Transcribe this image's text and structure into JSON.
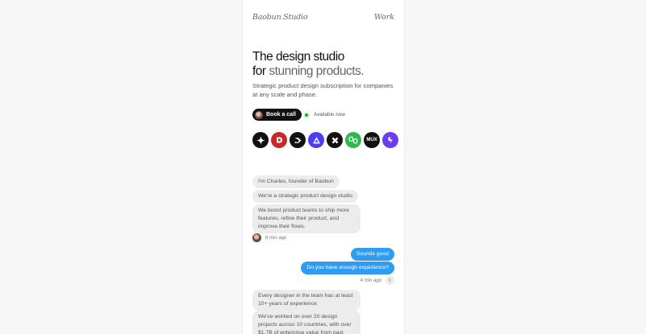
{
  "nav": {
    "brand": "Baobun.Studio",
    "work_link": "Work"
  },
  "hero": {
    "title_line1": "The design studio",
    "title_line2_dark": "for",
    "title_line2_muted": " stunning products.",
    "subtitle": "Strategic product design subscription for companies at any scale and phase."
  },
  "cta": {
    "book_label": "Book a call",
    "availability": "Available now"
  },
  "logos": [
    {
      "name": "sparkle-logo",
      "bg": "#111111"
    },
    {
      "name": "d-logo",
      "bg": "#c42a2a"
    },
    {
      "name": "arrow-logo",
      "bg": "#111111"
    },
    {
      "name": "triangle-logo",
      "bg": "#4b3df2"
    },
    {
      "name": "x-logo",
      "bg": "#111111"
    },
    {
      "name": "pd-logo",
      "bg": "#2eb84f",
      "text": "pd"
    },
    {
      "name": "mux-logo",
      "bg": "#111111",
      "text": "MUX"
    },
    {
      "name": "blob-logo",
      "bg": "#6b3df2"
    }
  ],
  "chat": {
    "in_1": "I'm Charles, founder of Baobun",
    "in_2": "We're a strategic product design studio",
    "in_3": "We boost product teams to ship more features, refine their product, and improve their flows.",
    "in_time": "6 min ago",
    "out_1": "Sounds good",
    "out_2": "Do you have enough experience?",
    "out_time": "4 min ago",
    "out_badge": "K",
    "in_4": "Every designer in the team has at least 10+ years of experience.",
    "in_5": "We've worked on over 20 design projects across 10 countries, with over $1.7B of enterprise value from past"
  },
  "colors": {
    "accent_blue": "#2d9cf2",
    "available_green": "#1fa34a"
  }
}
